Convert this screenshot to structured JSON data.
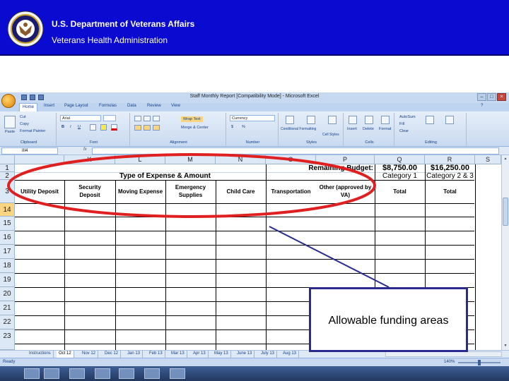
{
  "header": {
    "title": "U.S. Department of Veterans Affairs",
    "subtitle": "Veterans Health Administration",
    "bg_color": "#0a0ad0"
  },
  "excel": {
    "window_title": "Staff Monthly Report  [Compatibility Mode] - Microsoft Excel",
    "tabs": [
      "Home",
      "Insert",
      "Page Layout",
      "Formulas",
      "Data",
      "Review",
      "View"
    ],
    "active_tab": "Home",
    "ribbon": {
      "clipboard": {
        "label": "Clipboard",
        "paste": "Paste",
        "cut": "Cut",
        "copy": "Copy",
        "format_painter": "Format Painter"
      },
      "font": {
        "label": "Font",
        "font_name": "Arial",
        "bold": "B",
        "italic": "I",
        "underline": "U"
      },
      "alignment": {
        "label": "Alignment",
        "wrap_text": "Wrap Text",
        "merge_center": "Merge & Center"
      },
      "number": {
        "label": "Number",
        "format": "Currency",
        "currency_symbol": "$",
        "percent": "%"
      },
      "styles": {
        "label": "Styles",
        "conditional": "Conditional Formatting",
        "format_table": "Format as Table",
        "cell_styles": "Cell Styles"
      },
      "cells": {
        "label": "Cells",
        "insert": "Insert",
        "delete": "Delete",
        "format": "Format"
      },
      "editing": {
        "label": "Editing",
        "autosum": "AutoSum",
        "fill": "Fill",
        "clear": "Clear",
        "sort_filter": "Sort & Filter",
        "find_select": "Find & Select"
      }
    },
    "name_box": "III4",
    "fx": "fx",
    "columns": [
      "K",
      "L",
      "M",
      "N",
      "O",
      "P",
      "Q",
      "R",
      "S"
    ],
    "rows": [
      "1",
      "2",
      "3",
      "14",
      "15",
      "16",
      "17",
      "18",
      "19",
      "20",
      "21",
      "22",
      "23"
    ],
    "cells": {
      "remaining_budget": "Remaining Budget:",
      "q1": "$8,750.00",
      "r1": "$16,250.00",
      "type_header": "Type of Expense & Amount",
      "q2": "Category 1",
      "r2": "Category 2 & 3",
      "utility": "Utility Deposit",
      "security_1": "Security",
      "security_2": "Deposit",
      "moving": "Moving Expense",
      "emergency_1": "Emergency",
      "emergency_2": "Supplies",
      "child_care": "Child Care",
      "transportation": "Transportation",
      "other_1": "Other (approved by",
      "other_2": "VA)",
      "total_q": "Total",
      "total_r": "Total"
    },
    "sheet_tabs": [
      "Instructions",
      "Oct 12",
      "Nov 12",
      "Dec 12",
      "Jan 13",
      "Feb 13",
      "Mar 13",
      "Apr 13",
      "May 13",
      "June 13",
      "July 13",
      "Aug 13"
    ],
    "active_sheet": "Oct 12",
    "status": "Ready",
    "zoom": "140%"
  },
  "annotation": {
    "callout_text": "Allowable funding areas",
    "ellipse_color": "#e02020",
    "line_color": "#2b2b8f"
  }
}
